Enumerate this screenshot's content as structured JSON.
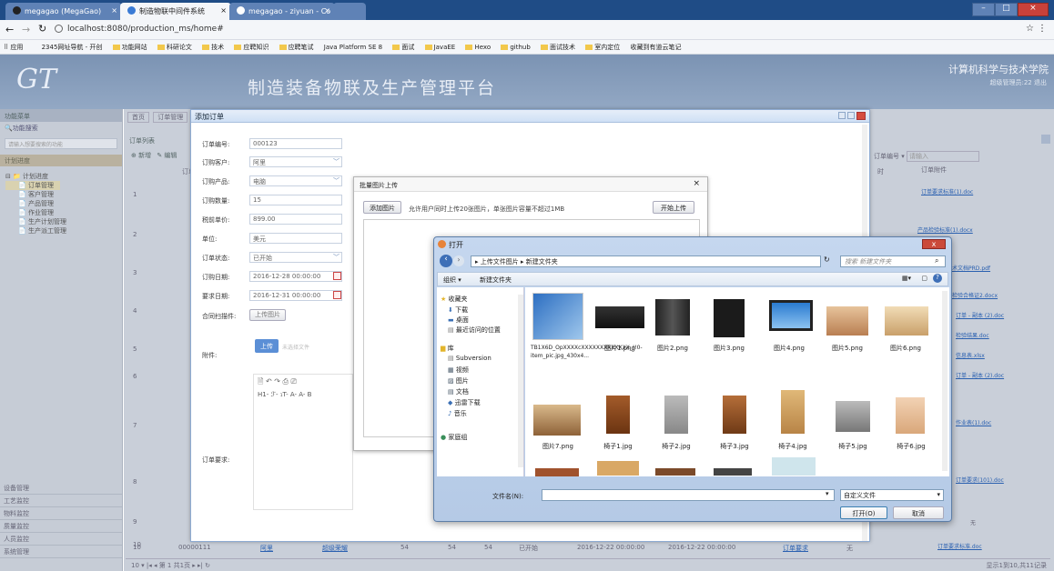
{
  "browser": {
    "tabs": [
      {
        "label": "megagao (MegaGao)",
        "close": "×"
      },
      {
        "label": "制造物联中间件系统",
        "close": "×"
      },
      {
        "label": "megagao - ziyuan - Co",
        "close": "×"
      }
    ],
    "url": "localhost:8080/production_ms/home#",
    "window_controls": [
      "–",
      "□",
      "×"
    ],
    "bookmarks": [
      "应用",
      "2345网址导航 - 开创",
      "功能网站",
      "科研论文",
      "技术",
      "应聘知识",
      "应聘笔试",
      "Java Platform SE 8",
      "面试",
      "JavaEE",
      "Hexo",
      "github",
      "面试技术",
      "室内定位",
      "收藏到有道云笔记"
    ]
  },
  "header": {
    "logo": "GT",
    "title": "制造装备物联及生产管理平台",
    "school": "计算机科学与技术学院",
    "user": "超级管理员:22  退出"
  },
  "sidebar": {
    "header": "功能菜单",
    "search_label": "功能搜索",
    "search_placeholder": "请输入想要搜索的功能",
    "section": "计划进度",
    "tree_root": "计划进度",
    "tree_items": [
      "订单管理",
      "客户管理",
      "产品管理",
      "作业管理",
      "生产计划管理",
      "生产派工管理"
    ],
    "bottom_items": [
      "设备管理",
      "工艺监控",
      "物料监控",
      "质量监控",
      "人员监控",
      "系统管理"
    ]
  },
  "main": {
    "tabs": [
      "首页",
      "订单管理"
    ],
    "list_title": "订单列表",
    "toolbar": [
      "新增",
      "编辑"
    ],
    "col_order": "订单",
    "col_attach": "订单附件",
    "search_type": "订单编号",
    "search_placeholder": "请输入",
    "row_numbers": [
      "1",
      "2",
      "3",
      "4",
      "5",
      "6",
      "7",
      "8",
      "9",
      "10"
    ],
    "attachments": [
      "订单要求标准(1).doc",
      "产品检验标准(1).docx",
      "技术文档PRD.pdf",
      "检验合格证2.docx",
      "订单 - 副本 (2).doc",
      "检验结果.doc",
      "信息表.xlsx",
      "订单 - 副本 (2).doc",
      "作业表(1).doc",
      "",
      "订单要求(101).doc",
      "",
      "订单要求标准.doc"
    ],
    "row10": [
      "10",
      "00000111",
      "阿里",
      "超级荣耀",
      "54",
      "54",
      "54",
      "已开始",
      "2016-12-22 00:00:00",
      "2016-12-22 00:00:00",
      "订单要求",
      "无"
    ],
    "row9_none": "无",
    "pager": "10 ▾  |◂ ◂ 第 1 共1页 ▸ ▸|  ↻",
    "pager_info": "显示1到10,共11记录"
  },
  "order_dialog": {
    "title": "添加订单",
    "fields": [
      {
        "label": "订单编号:",
        "value": "000123"
      },
      {
        "label": "订购客户:",
        "value": "阿里"
      },
      {
        "label": "订购产品:",
        "value": "电脑"
      },
      {
        "label": "订购数量:",
        "value": "15"
      },
      {
        "label": "税前单价:",
        "value": "899.00"
      },
      {
        "label": "单位:",
        "value": "美元"
      },
      {
        "label": "订单状态:",
        "value": "已开始"
      },
      {
        "label": "订购日期:",
        "value": "2016-12-28 00:00:00"
      },
      {
        "label": "要求日期:",
        "value": "2016-12-31 00:00:00"
      },
      {
        "label": "合同扫描件:",
        "value": "上传图片"
      }
    ],
    "attach_label": "附件:",
    "upload_btn": "上传",
    "upload_hint": "未选择文件",
    "editor_row2": "H1- ℱ- ₁T- A- A- B",
    "req_label": "订单要求:"
  },
  "batch_dialog": {
    "title": "批量图片上传",
    "close": "×",
    "add_btn": "添加图片",
    "hint": "允许用户同时上传20张图片，单张图片容量不超过1MB",
    "start_btn": "开始上传"
  },
  "open_dialog": {
    "title": "打开",
    "breadcrumb": "▸ 上传文件图片 ▸ 新建文件夹",
    "search_placeholder": "搜索 新建文件夹",
    "organize": "组织 ▾",
    "new_folder": "新建文件夹",
    "nav": [
      {
        "label": "收藏夹",
        "indent": 0
      },
      {
        "label": "下载",
        "indent": 1
      },
      {
        "label": "桌面",
        "indent": 1
      },
      {
        "label": "最近访问的位置",
        "indent": 1
      },
      {
        "label": "库",
        "indent": 0
      },
      {
        "label": "Subversion",
        "indent": 1
      },
      {
        "label": "视频",
        "indent": 1
      },
      {
        "label": "图片",
        "indent": 1
      },
      {
        "label": "文档",
        "indent": 1
      },
      {
        "label": "迅雷下载",
        "indent": 1
      },
      {
        "label": "音乐",
        "indent": 1
      },
      {
        "label": "家庭组",
        "indent": 0
      }
    ],
    "files_row1": [
      "TB1X6D_OpXXXXcXXXXXXXXXXXXX_!!0-item_pic.jpg_430x4...",
      "图片1.png",
      "图片2.png",
      "图片3.png",
      "图片4.png",
      "图片5.png",
      "图片6.png"
    ],
    "files_row2": [
      "图片7.png",
      "椅子1.jpg",
      "椅子2.jpg",
      "椅子3.jpg",
      "椅子4.jpg",
      "椅子5.jpg",
      "椅子6.jpg"
    ],
    "filename_label": "文件名(N):",
    "filter": "自定义文件",
    "open_btn": "打开(O)",
    "cancel_btn": "取消"
  },
  "colors": {
    "tabbar": "#1f4c86",
    "header": "#7b93b3",
    "accent": "#2a60b0",
    "dialog_title": "#cfe0f5"
  }
}
